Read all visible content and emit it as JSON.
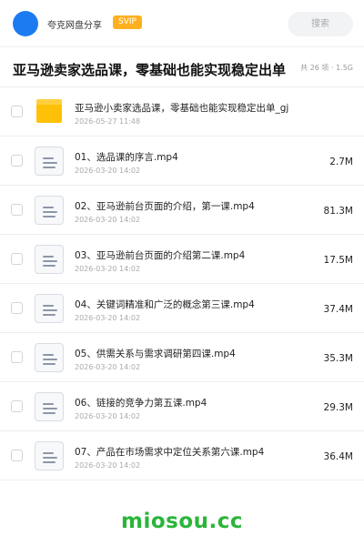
{
  "header": {
    "user_name": "夸克网盘分享",
    "badge": "SVIP",
    "search_label": "搜索"
  },
  "share": {
    "title": "亚马逊卖家选品课，零基础也能实现稳定出单",
    "meta": "共 26 项 · 1.5G"
  },
  "files": [
    {
      "icon": "folder-icon",
      "name": "亚马逊小卖家选品课，零基础也能实现稳定出单_gj",
      "date": "2026-05-27 11:48",
      "size": ""
    },
    {
      "icon": "video-file-icon",
      "name": "01、选品课的序言.mp4",
      "date": "2026-03-20 14:02",
      "size": "2.7M"
    },
    {
      "icon": "video-file-icon",
      "name": "02、亚马逊前台页面的介绍，第一课.mp4",
      "date": "2026-03-20 14:02",
      "size": "81.3M"
    },
    {
      "icon": "video-file-icon",
      "name": "03、亚马逊前台页面的介绍第二课.mp4",
      "date": "2026-03-20 14:02",
      "size": "17.5M"
    },
    {
      "icon": "video-file-icon",
      "name": "04、关键词精准和广泛的概念第三课.mp4",
      "date": "2026-03-20 14:02",
      "size": "37.4M"
    },
    {
      "icon": "video-file-icon",
      "name": "05、供需关系与需求调研第四课.mp4",
      "date": "2026-03-20 14:02",
      "size": "35.3M"
    },
    {
      "icon": "video-file-icon",
      "name": "06、链接的竞争力第五课.mp4",
      "date": "2026-03-20 14:02",
      "size": "29.3M"
    },
    {
      "icon": "video-file-icon",
      "name": "07、产品在市场需求中定位关系第六课.mp4",
      "date": "2026-03-20 14:02",
      "size": "36.4M"
    }
  ],
  "watermark": "miosou.cc",
  "colors": {
    "avatar": "#1d7bf2",
    "svip_badge": "#ffb020",
    "folder": "#ffc107",
    "watermark": "#2ab53a"
  }
}
